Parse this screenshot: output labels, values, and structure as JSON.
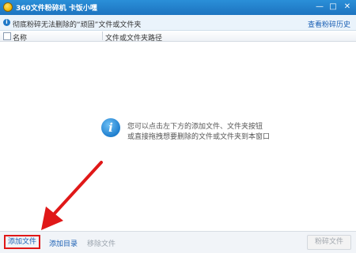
{
  "window": {
    "title": "360文件粉碎机  卡饭小嘿",
    "min_glyph": "—",
    "max_glyph": "□",
    "close_glyph": "✕"
  },
  "infobar": {
    "text": "彻底粉碎无法删除的“顽固”文件或文件夹",
    "history_link": "查看粉碎历史",
    "icon_glyph": "i"
  },
  "list": {
    "columns": [
      "名称",
      "文件或文件夹路径"
    ],
    "hint_lines": [
      "您可以点击左下方的添加文件、文件夹按钮",
      "或直接拖拽想要删除的文件或文件夹到本窗口"
    ],
    "hint_icon_glyph": "i"
  },
  "toolbar": {
    "add_file": "添加文件",
    "add_dir": "添加目录",
    "remove_file": "移除文件",
    "shred": "粉碎文件"
  },
  "colors": {
    "title_bar": "#1d74c0",
    "highlight": "#e01818",
    "link": "#1a5fb4"
  }
}
